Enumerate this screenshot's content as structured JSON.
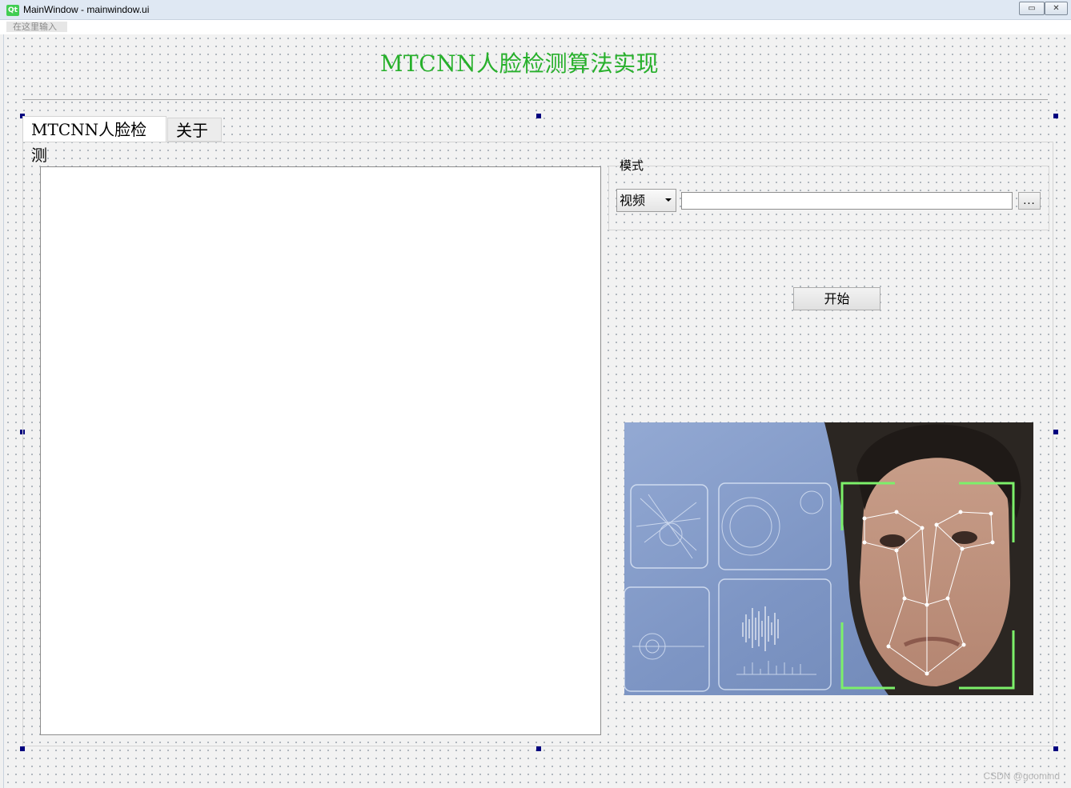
{
  "window": {
    "logo_text": "Qt",
    "title": "MainWindow - mainwindow.ui",
    "minimize_glyph": "▭",
    "close_glyph": "✕"
  },
  "menubar": {
    "placeholder": "在这里输入"
  },
  "header": {
    "title": "MTCNN人脸检测算法实现",
    "title_color": "#27b02b"
  },
  "tabs": [
    {
      "label": "MTCNN人脸检测",
      "active": true
    },
    {
      "label": "关于",
      "active": false
    }
  ],
  "mode_group": {
    "title": "模式",
    "mode_select": {
      "value": "视频",
      "icon": "chevron-down-icon"
    },
    "path_input": {
      "value": ""
    },
    "browse_label": "..."
  },
  "start_button": {
    "label": "开始"
  },
  "watermark": "CSDN @goomind"
}
